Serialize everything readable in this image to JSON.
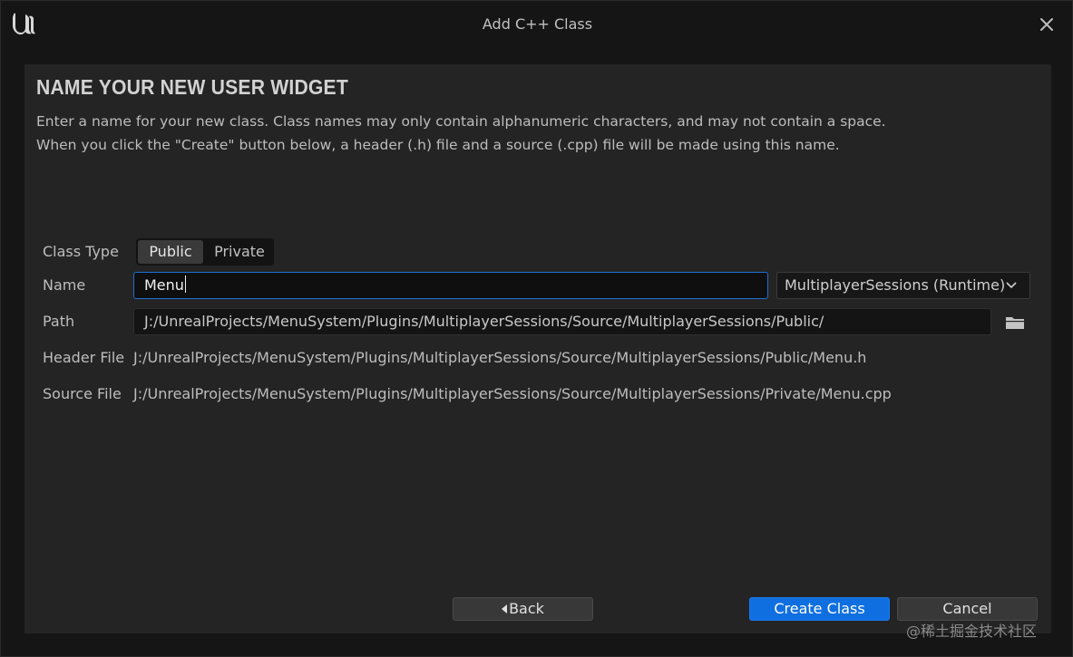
{
  "window": {
    "title": "Add C++ Class",
    "logo_icon": "unreal-engine-logo",
    "close_icon": "close-icon"
  },
  "header": {
    "heading": "NAME YOUR NEW USER WIDGET",
    "description_line1": "Enter a name for your new class. Class names may only contain alphanumeric characters, and may not contain a space.",
    "description_line2": "When you click the \"Create\" button below, a header (.h) file and a source (.cpp) file will be made using this name."
  },
  "form": {
    "class_type": {
      "label": "Class Type",
      "options": [
        "Public",
        "Private"
      ],
      "selected": "Public"
    },
    "name": {
      "label": "Name",
      "value": "Menu"
    },
    "module": {
      "selected": "MultiplayerSessions (Runtime)"
    },
    "path": {
      "label": "Path",
      "value": "J:/UnrealProjects/MenuSystem/Plugins/MultiplayerSessions/Source/MultiplayerSessions/Public/"
    },
    "header_file": {
      "label": "Header File",
      "value": "J:/UnrealProjects/MenuSystem/Plugins/MultiplayerSessions/Source/MultiplayerSessions/Public/Menu.h"
    },
    "source_file": {
      "label": "Source File",
      "value": "J:/UnrealProjects/MenuSystem/Plugins/MultiplayerSessions/Source/MultiplayerSessions/Private/Menu.cpp"
    }
  },
  "footer": {
    "back_label": "Back",
    "create_label": "Create Class",
    "cancel_label": "Cancel"
  },
  "watermark": "@稀土掘金技术社区",
  "colors": {
    "accent": "#0f6fe0",
    "background": "#242424",
    "frame": "#151515"
  }
}
